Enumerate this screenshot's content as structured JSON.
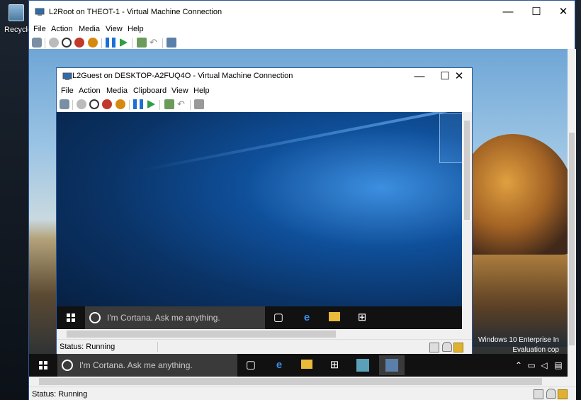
{
  "desktop": {
    "recycle_label": "Recycle"
  },
  "outer": {
    "title": "L2Root on THEOT-1 - Virtual Machine Connection",
    "menu": [
      "File",
      "Action",
      "Media",
      "View",
      "Help"
    ],
    "status": "Status: Running",
    "taskbar": {
      "cortana_placeholder": "I'm Cortana. Ask me anything."
    },
    "watermark_line1": "Windows 10 Enterprise In",
    "watermark_line2": "Evaluation cop"
  },
  "inner": {
    "title": "L2Guest on DESKTOP-A2FUQ4O - Virtual Machine Connection",
    "menu": [
      "File",
      "Action",
      "Media",
      "Clipboard",
      "View",
      "Help"
    ],
    "status": "Status: Running",
    "taskbar": {
      "cortana_placeholder": "I'm Cortana. Ask me anything."
    }
  },
  "window_controls": {
    "minimize": "—",
    "maximize": "☐",
    "close": "✕"
  },
  "colors": {
    "titlebar_border": "#2b5797",
    "taskbar": "#111111",
    "cortana_box": "#3a3a3a",
    "start_green": "#2ea043",
    "stop_red": "#c0392b",
    "shutdown_orange": "#d68910",
    "pause_blue": "#1e6fd6"
  }
}
